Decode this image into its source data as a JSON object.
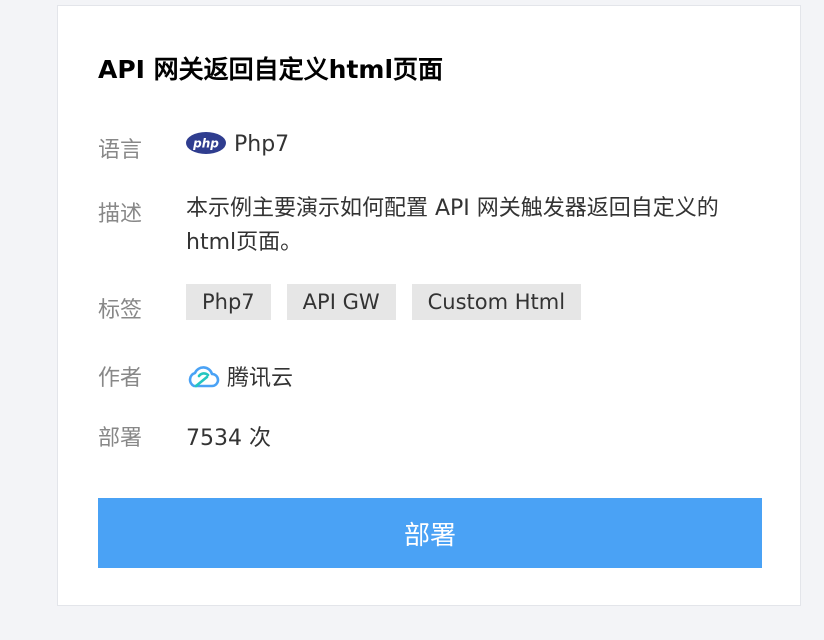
{
  "card": {
    "title": "API 网关返回自定义html页面"
  },
  "fields": {
    "language": {
      "label": "语言",
      "value": "Php7",
      "icon": "php-logo-icon"
    },
    "description": {
      "label": "描述",
      "value": "本示例主要演示如何配置 API 网关触发器返回自定义的html页面。"
    },
    "tags": {
      "label": "标签",
      "items": [
        "Php7",
        "API GW",
        "Custom Html"
      ]
    },
    "author": {
      "label": "作者",
      "value": "腾讯云",
      "icon": "tencent-cloud-icon"
    },
    "deploys": {
      "label": "部署",
      "value": "7534 次"
    }
  },
  "actions": {
    "deploy_label": "部署"
  },
  "colors": {
    "accent": "#4aa2f5",
    "php_badge": "#2f3d8f",
    "tag_bg": "#e6e6e6",
    "page_bg": "#f3f4f7"
  }
}
